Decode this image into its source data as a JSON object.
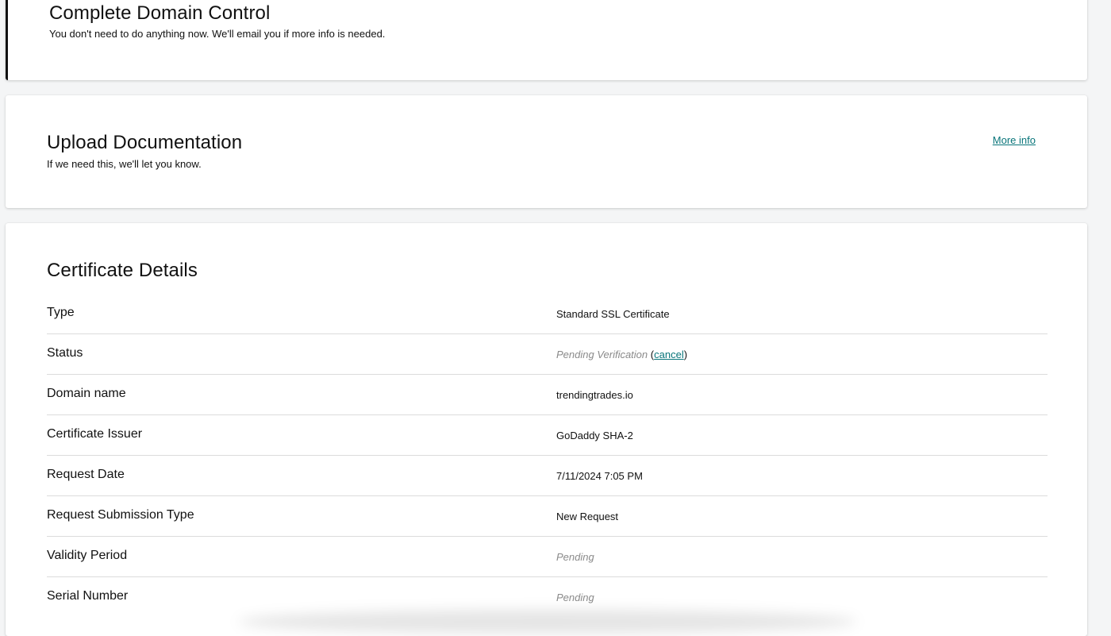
{
  "domain_control": {
    "title": "Complete Domain Control",
    "subtitle": "You don't need to do anything now. We'll email you if more info is needed."
  },
  "upload_documentation": {
    "title": "Upload Documentation",
    "subtitle": "If we need this, we'll let you know.",
    "more_info_label": "More info"
  },
  "certificate_details": {
    "title": "Certificate Details",
    "rows": [
      {
        "label": "Type",
        "value": "Standard SSL Certificate"
      },
      {
        "label": "Status",
        "value": "Pending Verification",
        "open_paren": "(",
        "cancel_label": "cancel",
        "close_paren": ")"
      },
      {
        "label": "Domain name",
        "value": "trendingtrades.io"
      },
      {
        "label": "Certificate Issuer",
        "value": "GoDaddy SHA-2"
      },
      {
        "label": "Request Date",
        "value": "7/11/2024 7:05 PM"
      },
      {
        "label": "Request Submission Type",
        "value": "New Request"
      },
      {
        "label": "Validity Period",
        "value": "Pending"
      },
      {
        "label": "Serial Number",
        "value": "Pending"
      }
    ]
  },
  "colors": {
    "link": "#09757a",
    "pending_text": "#8a8a8a",
    "accent_border": "#111111"
  }
}
